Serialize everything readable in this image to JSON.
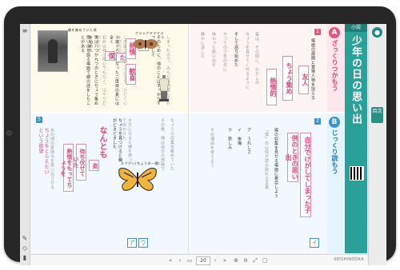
{
  "book": {
    "title": "少年の日の思い出",
    "grade_tag": "小説",
    "section_a": {
      "letter": "A",
      "label": "ざっくりつかもう"
    },
    "section_b": {
      "letter": "B",
      "label": "じっくり読もう"
    },
    "page_numbers": {
      "left_top": "32",
      "right_top": "33"
    }
  },
  "left_page": {
    "photo_caption": "蝶を集めていた頃",
    "keywords": [
      "熱情",
      "歓喜",
      "十",
      "僕",
      "た"
    ],
    "bottom_keywords": [
      "熱情をもってちょうを",
      "待ち伏せていた",
      "なんとも",
      "ちょうをとらえたいという欲望",
      "姿"
    ],
    "option_labels": [
      "ア",
      "ウ"
    ],
    "moth_caption": "クジャクヤママユ",
    "butterfly_caption": "キアゲハ(ちょうの一種)"
  },
  "right_page": {
    "keywords_a": [
      "ちょう集め",
      "友人",
      "熱情的"
    ],
    "keywords_b": [
      "自分でけがしてしまった子",
      "供のときの思い出"
    ],
    "option_labels": [
      "イ"
    ]
  },
  "toolbar": {
    "page_value": "20",
    "brand": "SEISHINDOKA"
  },
  "sidebar": {
    "avatar_icon": "user-icon",
    "side_button_label": "目次"
  },
  "colors": {
    "teal": "#2aa198",
    "pink": "#e58fa8",
    "blue": "#3a93d6",
    "orange": "#f0a03c"
  }
}
